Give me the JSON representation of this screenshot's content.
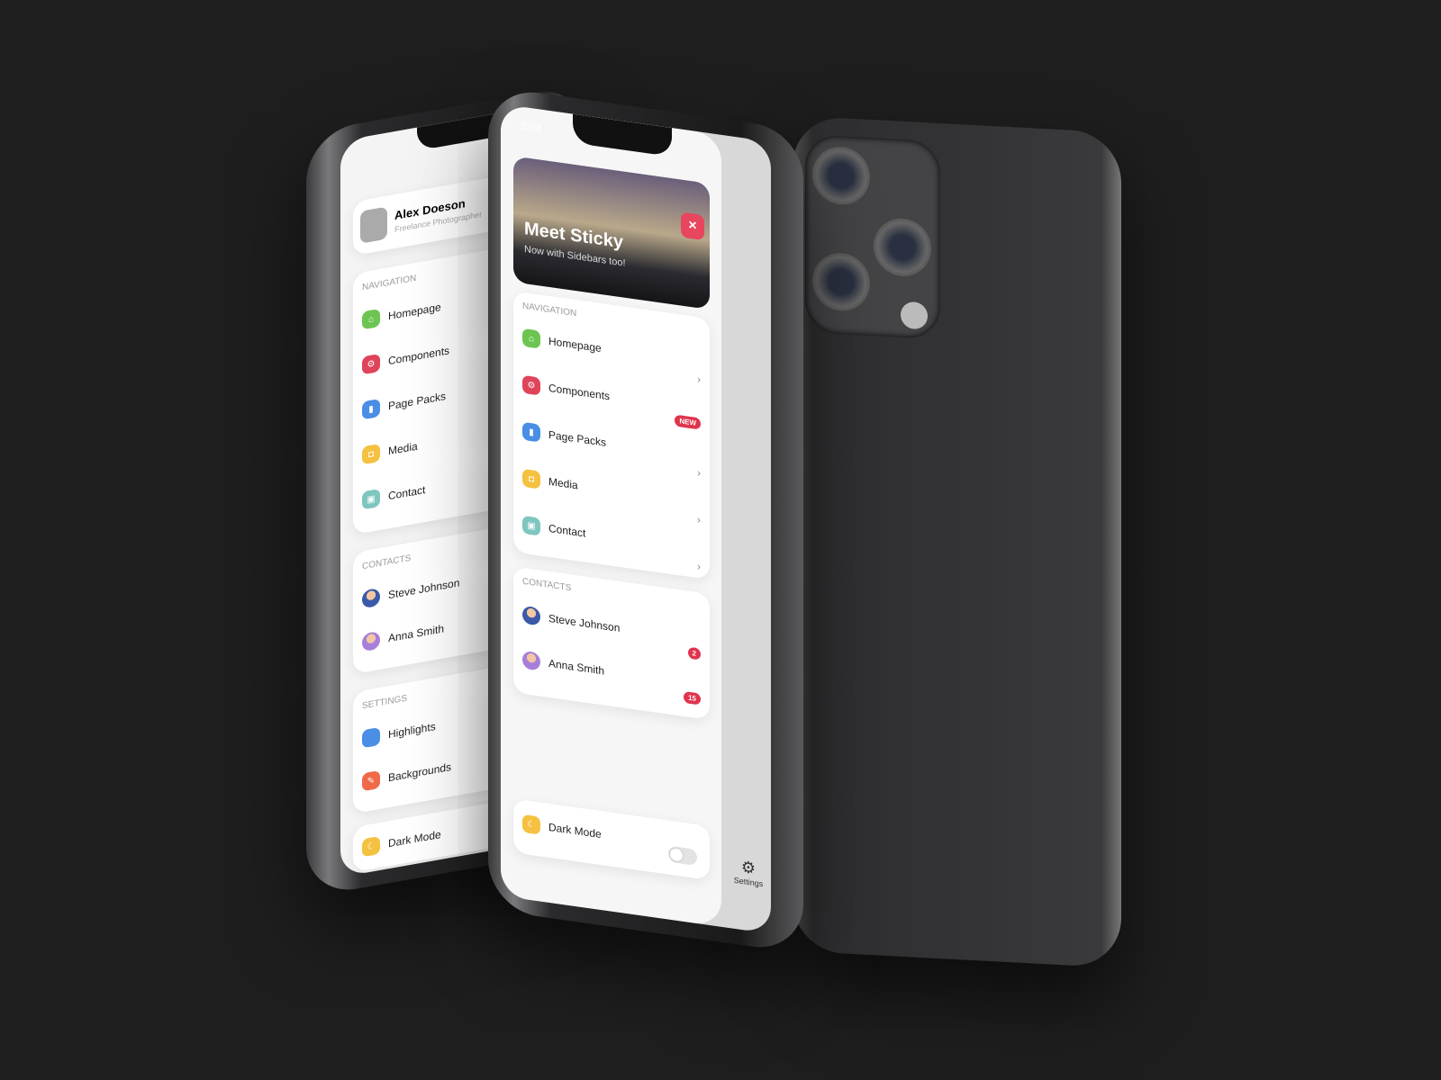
{
  "profile": {
    "name": "Alex Doeson",
    "role": "Freelance Photographer"
  },
  "status_time": "3:04",
  "hero": {
    "title": "Meet Sticky",
    "subtitle": "Now with Sidebars too!",
    "close_icon": "close-icon"
  },
  "navigation": {
    "header": "Navigation",
    "items": [
      {
        "label": "Homepage",
        "icon": "home-icon",
        "color": "#6cc551"
      },
      {
        "label": "Components",
        "icon": "gear-icon",
        "color": "#e0445a"
      },
      {
        "label": "Page Packs",
        "icon": "file-icon",
        "color": "#4a8ee6"
      },
      {
        "label": "Media",
        "icon": "camera-icon",
        "color": "#f5c140"
      },
      {
        "label": "Contact",
        "icon": "image-icon",
        "color": "#7fc6c0"
      }
    ],
    "new_badge": "NEW"
  },
  "contacts": {
    "header": "Contacts",
    "items": [
      {
        "name": "Steve Johnson",
        "count": "2"
      },
      {
        "name": "Anna Smith",
        "count": "15"
      }
    ]
  },
  "settings": {
    "header": "Settings",
    "items": [
      {
        "label": "Highlights",
        "color": "#4a8ee6"
      },
      {
        "label": "Backgrounds",
        "color": "#f06a4a"
      },
      {
        "label": "Dark Mode",
        "color": "#f5c140"
      }
    ]
  },
  "dark_mode": {
    "label": "Dark Mode",
    "enabled": false
  },
  "side_menu": {
    "settings_label": "Settings"
  }
}
